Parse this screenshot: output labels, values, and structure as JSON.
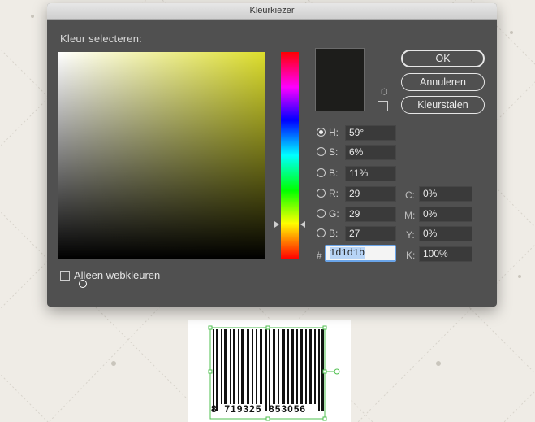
{
  "dialog": {
    "title": "Kleurkiezer",
    "select_label": "Kleur selecteren:",
    "buttons": {
      "ok": "OK",
      "cancel": "Annuleren",
      "swatches": "Kleurstalen"
    },
    "fields": {
      "h": {
        "label": "H:",
        "value": "59°"
      },
      "s": {
        "label": "S:",
        "value": "6%"
      },
      "b": {
        "label": "B:",
        "value": "11%"
      },
      "r": {
        "label": "R:",
        "value": "29"
      },
      "g": {
        "label": "G:",
        "value": "29"
      },
      "b2": {
        "label": "B:",
        "value": "27"
      }
    },
    "cmyk": {
      "c": {
        "label": "C:",
        "value": "0%"
      },
      "m": {
        "label": "M:",
        "value": "0%"
      },
      "y": {
        "label": "Y:",
        "value": "0%"
      },
      "k": {
        "label": "K:",
        "value": "100%"
      }
    },
    "hex": {
      "label": "#",
      "value": "1d1d1b"
    },
    "web_colors_label": "Alleen webkleuren",
    "current_color": "#1d1d1b",
    "hue_color": "#ddde2c"
  },
  "barcode": {
    "digits": "8  719325  853056"
  }
}
